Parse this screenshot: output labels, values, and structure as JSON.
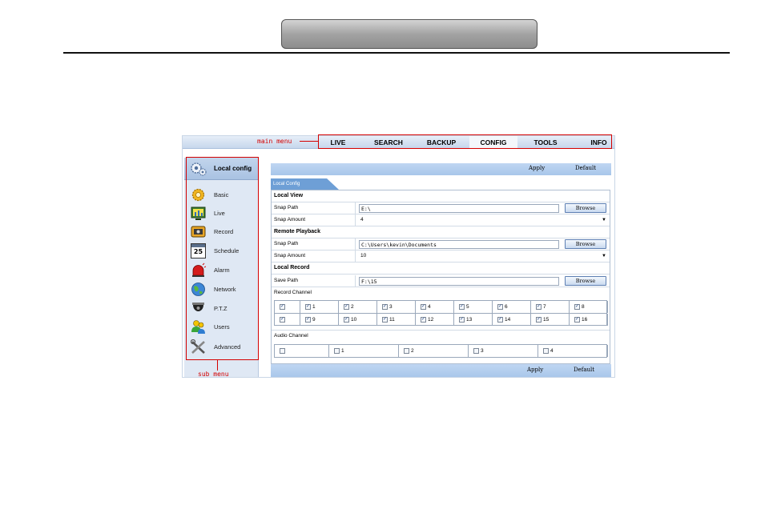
{
  "annotations": {
    "main_menu": "main menu",
    "sub_menu": "sub menu"
  },
  "colors": {
    "annotation": "#d40000",
    "accent": "#6e9fd6",
    "action_bar": "#bfd6f2"
  },
  "main_menu": [
    {
      "label": "LIVE",
      "active": false
    },
    {
      "label": "SEARCH",
      "active": false
    },
    {
      "label": "BACKUP",
      "active": false
    },
    {
      "label": "CONFIG",
      "active": true
    },
    {
      "label": "TOOLS",
      "active": false
    },
    {
      "label": "INFO",
      "active": false
    }
  ],
  "sidebar": {
    "header": "Local config",
    "header_icon": "gears-icon",
    "items": [
      {
        "label": "Basic",
        "icon": "gear-icon"
      },
      {
        "label": "Live",
        "icon": "monitor-icon"
      },
      {
        "label": "Record",
        "icon": "film-icon"
      },
      {
        "label": "Schedule",
        "icon": "calendar-icon",
        "icon_text": "25"
      },
      {
        "label": "Alarm",
        "icon": "siren-icon"
      },
      {
        "label": "Network",
        "icon": "globe-icon"
      },
      {
        "label": "P.T.Z",
        "icon": "dome-camera-icon"
      },
      {
        "label": "Users",
        "icon": "users-icon"
      },
      {
        "label": "Advanced",
        "icon": "tools-icon"
      }
    ]
  },
  "actions": {
    "apply": "Apply",
    "default": "Default"
  },
  "tab": "Local Config",
  "form": {
    "local_view": {
      "title": "Local View",
      "snap_path_label": "Snap Path",
      "snap_path": "E:\\",
      "snap_amount_label": "Snap Amount",
      "snap_amount": "4"
    },
    "remote_playback": {
      "title": "Remote Playback",
      "snap_path_label": "Snap Path",
      "snap_path": "C:\\Users\\kevin\\Documents",
      "snap_amount_label": "Snap Amount",
      "snap_amount": "10"
    },
    "local_record": {
      "title": "Local Record",
      "save_path_label": "Save Path",
      "save_path": "F:\\15"
    },
    "browse_label": "Browse",
    "record_channel_label": "Record Channel",
    "record_channels": [
      [
        "1",
        "2",
        "3",
        "4",
        "5",
        "6",
        "7",
        "8"
      ],
      [
        "9",
        "10",
        "11",
        "12",
        "13",
        "14",
        "15",
        "16"
      ]
    ],
    "record_channels_checked": true,
    "audio_channel_label": "Audio Channel",
    "audio_channels": [
      "1",
      "2",
      "3",
      "4"
    ],
    "audio_channels_checked": false
  }
}
